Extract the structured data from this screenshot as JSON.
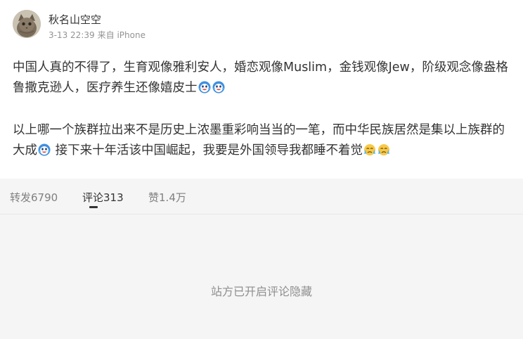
{
  "post": {
    "username": "秋名山空空",
    "date": "3-13 22:39",
    "source": "来自 iPhone",
    "paragraph1_text": "中国人真的不得了，生育观像雅利安人，婚恋观像Muslim，金钱观像Jew，阶级观念像盎格鲁撒克逊人，医疗养生还像嬉皮士",
    "paragraph2_text_a": "以上哪一个族群拉出来不是历史上浓墨重彩响当当的一笔，而中华民族居然是集以上族群的大成",
    "paragraph2_text_b": " 接下来十年活该中国崛起，我要是外国领导我都睡不着觉",
    "emojis": {
      "p1": [
        "laugh-cry-emoji",
        "laugh-cry-emoji"
      ],
      "p2a": [
        "laugh-cry-emoji"
      ],
      "p2b": [
        "cry-emoji",
        "cry-emoji"
      ]
    }
  },
  "tabs": [
    {
      "label": "转发",
      "count": "6790",
      "active": false
    },
    {
      "label": "评论",
      "count": "313",
      "active": true
    },
    {
      "label": "赞",
      "count": "1.4万",
      "active": false
    }
  ],
  "comments": {
    "notice": "站方已开启评论隐藏"
  },
  "colors": {
    "text_primary": "#333333",
    "text_meta": "#939393",
    "tab_inactive": "#808080",
    "background": "#f5f5f5",
    "card": "#ffffff"
  }
}
